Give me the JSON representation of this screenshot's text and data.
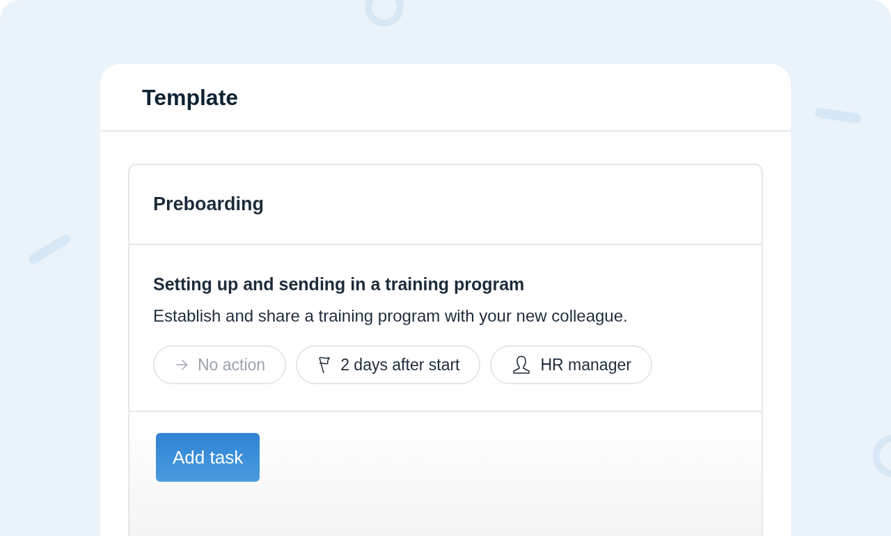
{
  "card": {
    "title": "Template"
  },
  "section": {
    "title": "Preboarding",
    "task": {
      "title": "Setting up and sending in a training program",
      "description": "Establish and share a training program with your new colleague.",
      "chips": [
        {
          "kind": "action",
          "label": "No action",
          "disabled": true
        },
        {
          "kind": "deadline",
          "label": "2 days after start",
          "disabled": false
        },
        {
          "kind": "assignee",
          "label": "HR manager",
          "disabled": false
        }
      ]
    },
    "button": "Add task"
  }
}
